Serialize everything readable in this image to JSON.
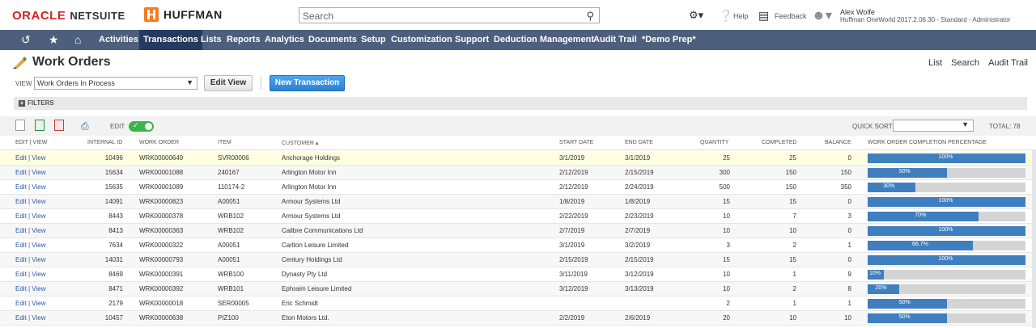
{
  "header": {
    "oracle": "ORACLE",
    "netsuite": "NETSUITE",
    "brand": "HUFFMAN",
    "search_placeholder": "Search",
    "help": "Help",
    "feedback": "Feedback",
    "user_name": "Alex Wolfe",
    "user_role": "Huffman OneWorld 2017.2.06.30 - Standard - Administrator"
  },
  "nav": {
    "items": [
      "Activities",
      "Transactions",
      "Lists",
      "Reports",
      "Analytics",
      "Documents",
      "Setup",
      "Customization",
      "Support",
      "Deduction Management",
      "Audit Trail",
      "*Demo Prep*"
    ],
    "active": "Transactions"
  },
  "page": {
    "title": "Work Orders",
    "links": [
      "List",
      "Search",
      "Audit Trail"
    ],
    "view_label": "VIEW",
    "view_value": "Work Orders In Process",
    "edit_view": "Edit View",
    "new_transaction": "New Transaction",
    "filters": "FILTERS",
    "edit_label": "EDIT",
    "quick_sort": "QUICK SORT",
    "total": "TOTAL: 78"
  },
  "table": {
    "columns": [
      "EDIT | VIEW",
      "INTERNAL ID",
      "WORK ORDER",
      "ITEM",
      "CUSTOMER ▴",
      "START DATE",
      "END DATE",
      "QUANTITY",
      "COMPLETED",
      "BALANCE",
      "WORK ORDER COMPLETION PERCENTAGE"
    ],
    "rows": [
      {
        "edit": "Edit | View",
        "id": "10496",
        "wo": "WRK00000649",
        "item": "SVR00006",
        "customer": "Anchorage Holdings",
        "start": "3/1/2019",
        "end": "3/1/2019",
        "qty": "25",
        "completed": "25",
        "balance": "0",
        "pct_label": "100%",
        "pct": 1.0
      },
      {
        "edit": "Edit | View",
        "id": "15634",
        "wo": "WRK00001088",
        "item": "240167",
        "customer": "Arlington Motor Inn",
        "start": "2/12/2019",
        "end": "2/15/2019",
        "qty": "300",
        "completed": "150",
        "balance": "150",
        "pct_label": "50%",
        "pct": 0.5
      },
      {
        "edit": "Edit | View",
        "id": "15635",
        "wo": "WRK00001089",
        "item": "110174-2",
        "customer": "Arlington Motor Inn",
        "start": "2/12/2019",
        "end": "2/24/2019",
        "qty": "500",
        "completed": "150",
        "balance": "350",
        "pct_label": "30%",
        "pct": 0.3
      },
      {
        "edit": "Edit | View",
        "id": "14091",
        "wo": "WRK00000823",
        "item": "A00051",
        "customer": "Armour Systems Ltd",
        "start": "1/8/2019",
        "end": "1/8/2019",
        "qty": "15",
        "completed": "15",
        "balance": "0",
        "pct_label": "100%",
        "pct": 1.0
      },
      {
        "edit": "Edit | View",
        "id": "8443",
        "wo": "WRK00000378",
        "item": "WRB102",
        "customer": "Armour Systems Ltd",
        "start": "2/22/2019",
        "end": "2/23/2019",
        "qty": "10",
        "completed": "7",
        "balance": "3",
        "pct_label": "70%",
        "pct": 0.7
      },
      {
        "edit": "Edit | View",
        "id": "8413",
        "wo": "WRK00000363",
        "item": "WRB102",
        "customer": "Calibre Communications Ltd",
        "start": "2/7/2019",
        "end": "2/7/2019",
        "qty": "10",
        "completed": "10",
        "balance": "0",
        "pct_label": "100%",
        "pct": 1.0
      },
      {
        "edit": "Edit | View",
        "id": "7634",
        "wo": "WRK00000322",
        "item": "A00051",
        "customer": "Carlton Leisure Limited",
        "start": "3/1/2019",
        "end": "3/2/2019",
        "qty": "3",
        "completed": "2",
        "balance": "1",
        "pct_label": "66.7%",
        "pct": 0.667
      },
      {
        "edit": "Edit | View",
        "id": "14031",
        "wo": "WRK00000793",
        "item": "A00051",
        "customer": "Century Holdings Ltd",
        "start": "2/15/2019",
        "end": "2/15/2019",
        "qty": "15",
        "completed": "15",
        "balance": "0",
        "pct_label": "100%",
        "pct": 1.0
      },
      {
        "edit": "Edit | View",
        "id": "8469",
        "wo": "WRK00000391",
        "item": "WRB100",
        "customer": "Dynasty Pty Ltd",
        "start": "3/11/2019",
        "end": "3/12/2019",
        "qty": "10",
        "completed": "1",
        "balance": "9",
        "pct_label": "10%",
        "pct": 0.1
      },
      {
        "edit": "Edit | View",
        "id": "8471",
        "wo": "WRK00000392",
        "item": "WRB101",
        "customer": "Ephraim Leisure Limited",
        "start": "3/12/2019",
        "end": "3/13/2019",
        "qty": "10",
        "completed": "2",
        "balance": "8",
        "pct_label": "20%",
        "pct": 0.2
      },
      {
        "edit": "Edit | View",
        "id": "2179",
        "wo": "WRK00000018",
        "item": "SER00005",
        "customer": "Eric Schmidt",
        "start": "",
        "end": "",
        "qty": "2",
        "completed": "1",
        "balance": "1",
        "pct_label": "50%",
        "pct": 0.5
      },
      {
        "edit": "Edit | View",
        "id": "10457",
        "wo": "WRK00000638",
        "item": "PIZ100",
        "customer": "Eton Motors Ltd.",
        "start": "2/2/2019",
        "end": "2/6/2019",
        "qty": "20",
        "completed": "10",
        "balance": "10",
        "pct_label": "50%",
        "pct": 0.5
      }
    ]
  },
  "icons": {
    "history": "history-icon",
    "star": "star-icon",
    "home": "home-icon",
    "search": "search-icon",
    "settings": "person-settings-icon",
    "help": "help-icon",
    "feedback": "feedback-icon",
    "avatar": "avatar-icon"
  }
}
